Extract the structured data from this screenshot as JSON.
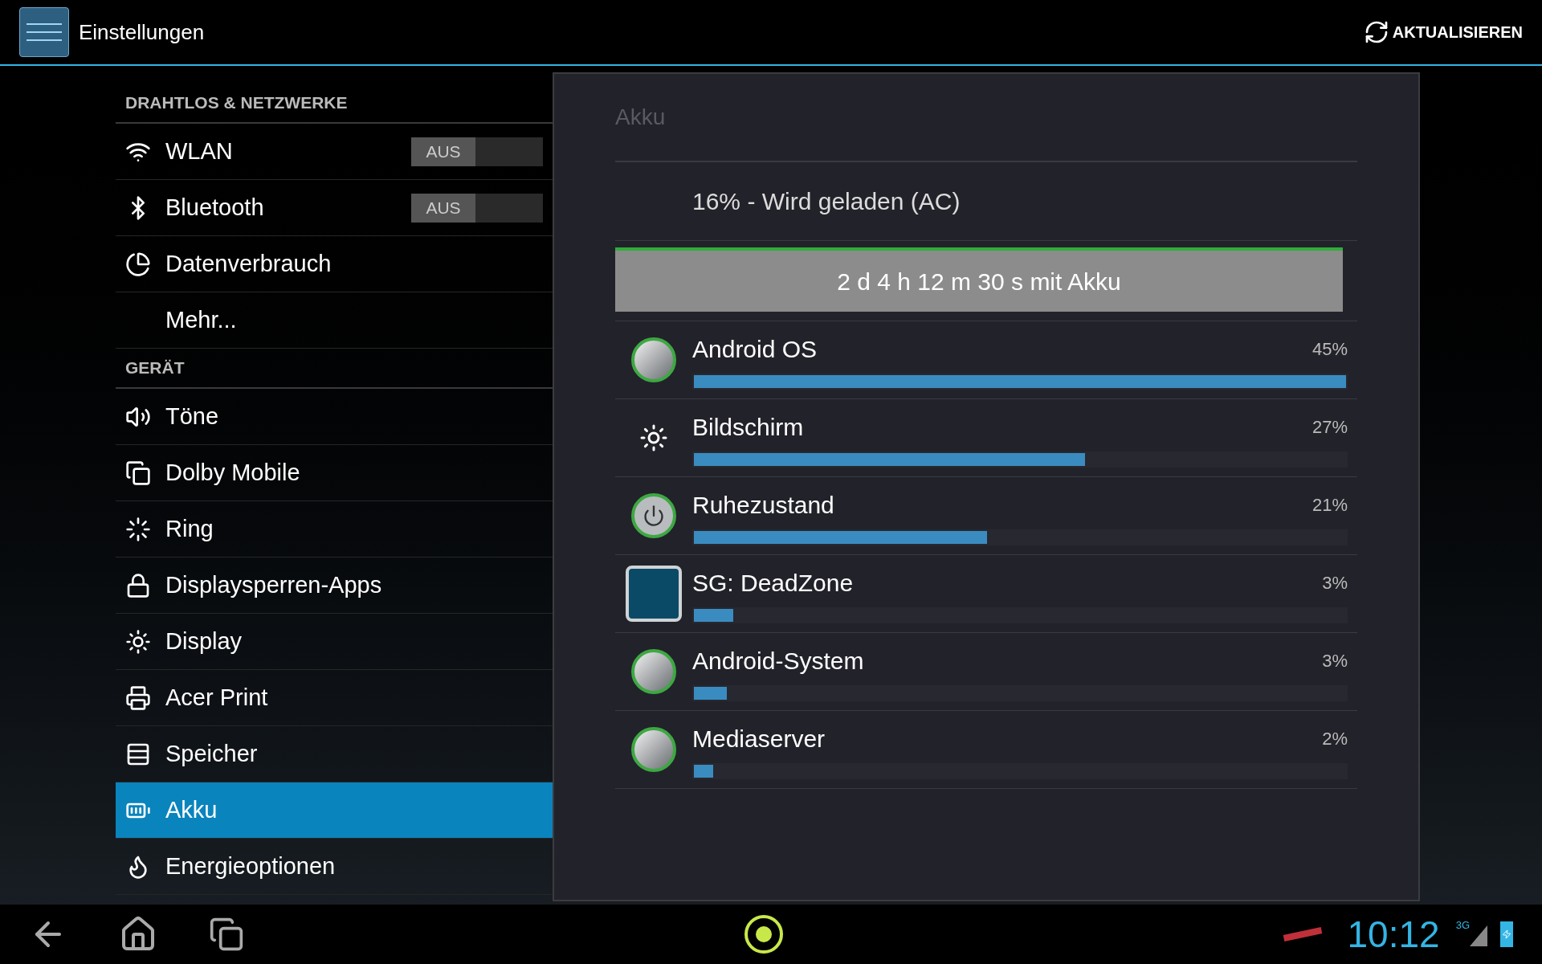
{
  "action_bar": {
    "title": "Einstellungen",
    "action": "AKTUALISIEREN"
  },
  "settings_list": [
    {
      "kind": "header",
      "label": "DRAHTLOS & NETZWERKE"
    },
    {
      "kind": "toggle",
      "label": "WLAN",
      "toggle": "AUS",
      "on": false,
      "selected": false
    },
    {
      "kind": "toggle",
      "label": "Bluetooth",
      "toggle": "AUS",
      "on": false,
      "selected": false
    },
    {
      "kind": "item",
      "label": "Datenverbrauch",
      "selected": false
    },
    {
      "kind": "item",
      "label": "Mehr...",
      "selected": false
    },
    {
      "kind": "header",
      "label": "GERÄT"
    },
    {
      "kind": "item",
      "label": "Töne",
      "selected": false
    },
    {
      "kind": "item",
      "label": "Dolby Mobile",
      "selected": false
    },
    {
      "kind": "item",
      "label": "Ring",
      "selected": false
    },
    {
      "kind": "item",
      "label": "Displaysperren-Apps",
      "selected": false
    },
    {
      "kind": "item",
      "label": "Display",
      "selected": false
    },
    {
      "kind": "item",
      "label": "Acer Print",
      "selected": false
    },
    {
      "kind": "item",
      "label": "Speicher",
      "selected": false
    },
    {
      "kind": "item",
      "label": "Akku",
      "selected": true
    },
    {
      "kind": "item",
      "label": "Energieoptionen",
      "selected": false
    }
  ],
  "battery_panel": {
    "title": "Akku",
    "status": "16% - Wird geladen (AC)",
    "graph_label": "2 d 4 h 12 m 30 s mit Akku",
    "usage": [
      {
        "name": "Android OS",
        "percent": "45%",
        "level": 1.0
      },
      {
        "name": "Bildschirm",
        "percent": "27%",
        "level": 0.6
      },
      {
        "name": "Ruhezustand",
        "percent": "21%",
        "level": 0.45
      },
      {
        "name": "SG: DeadZone",
        "percent": "3%",
        "level": 0.06
      },
      {
        "name": "Android-System",
        "percent": "3%",
        "level": 0.05
      },
      {
        "name": "Mediaserver",
        "percent": "2%",
        "level": 0.03
      }
    ]
  },
  "system_bar": {
    "time": "10:12",
    "network": "3G"
  }
}
